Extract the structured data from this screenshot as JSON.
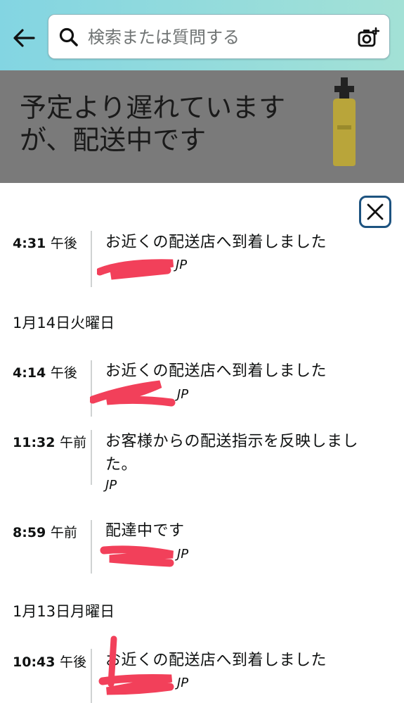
{
  "search": {
    "placeholder": "検索または質問する"
  },
  "banner": {
    "title": "予定より遅れていますが、配送中です"
  },
  "colors": {
    "header_start": "#83d5e2",
    "header_end": "#a3e1d6",
    "redaction": "#f2405a",
    "close_border": "#1d5380"
  },
  "timeline": {
    "events": [
      {
        "time": "4:31",
        "ampm": "午後",
        "title": "お近くの配送店へ到着しました",
        "location": "JP"
      },
      {
        "time": "4:14",
        "ampm": "午後",
        "title": "お近くの配送店へ到着しました",
        "location": "JP"
      },
      {
        "time": "11:32",
        "ampm": "午前",
        "title": "お客様からの配送指示を反映しました。",
        "location": "JP"
      },
      {
        "time": "8:59",
        "ampm": "午前",
        "title": "配達中です",
        "location": "JP"
      },
      {
        "time": "10:43",
        "ampm": "午後",
        "title": "お近くの配送店へ到着しました",
        "location": "JP"
      }
    ],
    "dates": [
      "1月14日火曜日",
      "1月13日月曜日"
    ]
  }
}
